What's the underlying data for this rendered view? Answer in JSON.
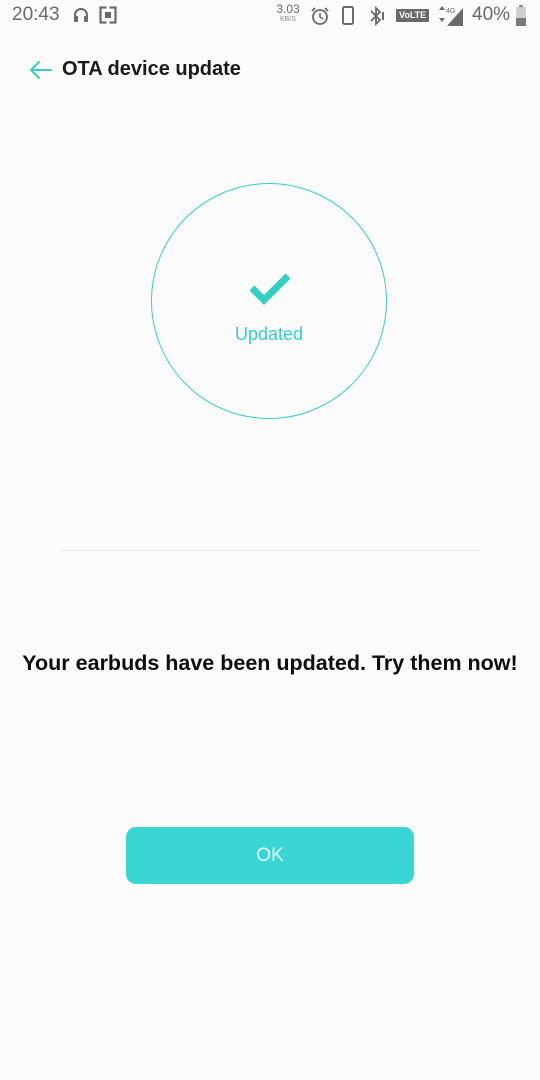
{
  "status_bar": {
    "time": "20:43",
    "net_speed_value": "3.03",
    "net_speed_unit": "KB/S",
    "volte": "VoLTE",
    "network": "4G",
    "battery_percent": "40%",
    "icons": [
      "headphones-icon",
      "screenshot-icon",
      "alarm-icon",
      "vibrate-icon",
      "bluetooth-icon",
      "signal-icon",
      "battery-icon"
    ]
  },
  "header": {
    "title": "OTA device update"
  },
  "update_status": {
    "label": "Updated",
    "icon": "checkmark-icon"
  },
  "message": "Your earbuds have been updated. Try them now!",
  "actions": {
    "ok_label": "OK"
  },
  "colors": {
    "accent": "#33cfc7",
    "button": "#3ad6d3",
    "background": "#fbfbfb",
    "text": "#0d0d0d"
  }
}
